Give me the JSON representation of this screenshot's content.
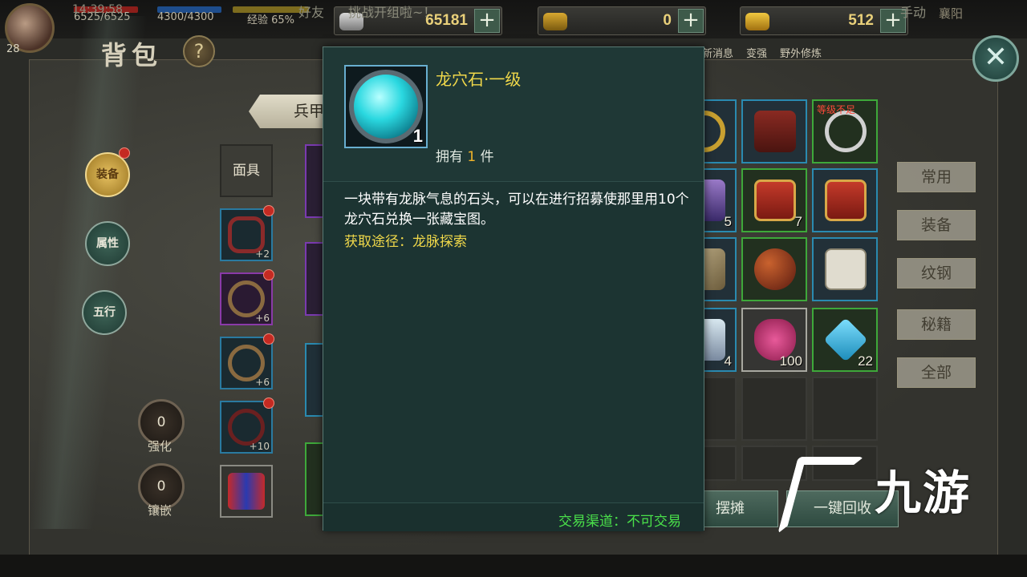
{
  "hud": {
    "level": "28",
    "hp": "6525/6525",
    "mp": "4300/4300",
    "exp": "经验 65%",
    "top_right": "襄阳",
    "currencies": [
      {
        "icon": "silver-ingot-icon",
        "value": "65181"
      },
      {
        "icon": "gold-ticket-icon",
        "value": "0"
      },
      {
        "icon": "gold-ingot-icon",
        "value": "512"
      }
    ],
    "menu": [
      "新消息",
      "变强",
      "野外修炼"
    ]
  },
  "bag": {
    "title": "背包",
    "help": "?",
    "close": "✕",
    "side_tabs": [
      "装备",
      "属性",
      "五行"
    ],
    "enhance": {
      "value": "0",
      "label": "强化"
    },
    "inlay": {
      "value": "0",
      "label": "镶嵌"
    },
    "category_tab": "兵甲",
    "mask_slot": "面具",
    "equip_levels": [
      "+2",
      "+6",
      "+6",
      "+10"
    ],
    "grid": [
      {
        "count": ""
      },
      {
        "count": ""
      },
      {
        "count": "",
        "warn": "等级不足"
      },
      {
        "count": "5"
      },
      {
        "count": "7"
      },
      {
        "count": ""
      },
      {
        "count": ""
      },
      {
        "count": ""
      },
      {
        "count": ""
      },
      {
        "count": "4"
      },
      {
        "count": "100"
      },
      {
        "count": "22"
      }
    ],
    "filters": [
      "常用",
      "装备",
      "纹钢",
      "秘籍",
      "全部"
    ],
    "stall_button": "摆摊",
    "recycle_button": "一键回收"
  },
  "tooltip": {
    "name": "龙穴石·一级",
    "icon_count": "1",
    "owned_prefix": "拥有",
    "owned_count": "1",
    "owned_suffix": "件",
    "description": "一块带有龙脉气息的石头，可以在进行招募使那里用10个龙穴石兑换一张藏宝图。",
    "source": "获取途径：龙脉探索",
    "trade": "交易渠道：不可交易"
  },
  "chat": {
    "time": "14:39:58",
    "friend": "好友",
    "message": "挑战开组啦~！",
    "auto": "手动"
  },
  "watermark": "九游",
  "colors": {
    "tooltip_title": "#f0d84a",
    "trade_green": "#4ae04a",
    "owned_orange": "#f0b42a"
  }
}
